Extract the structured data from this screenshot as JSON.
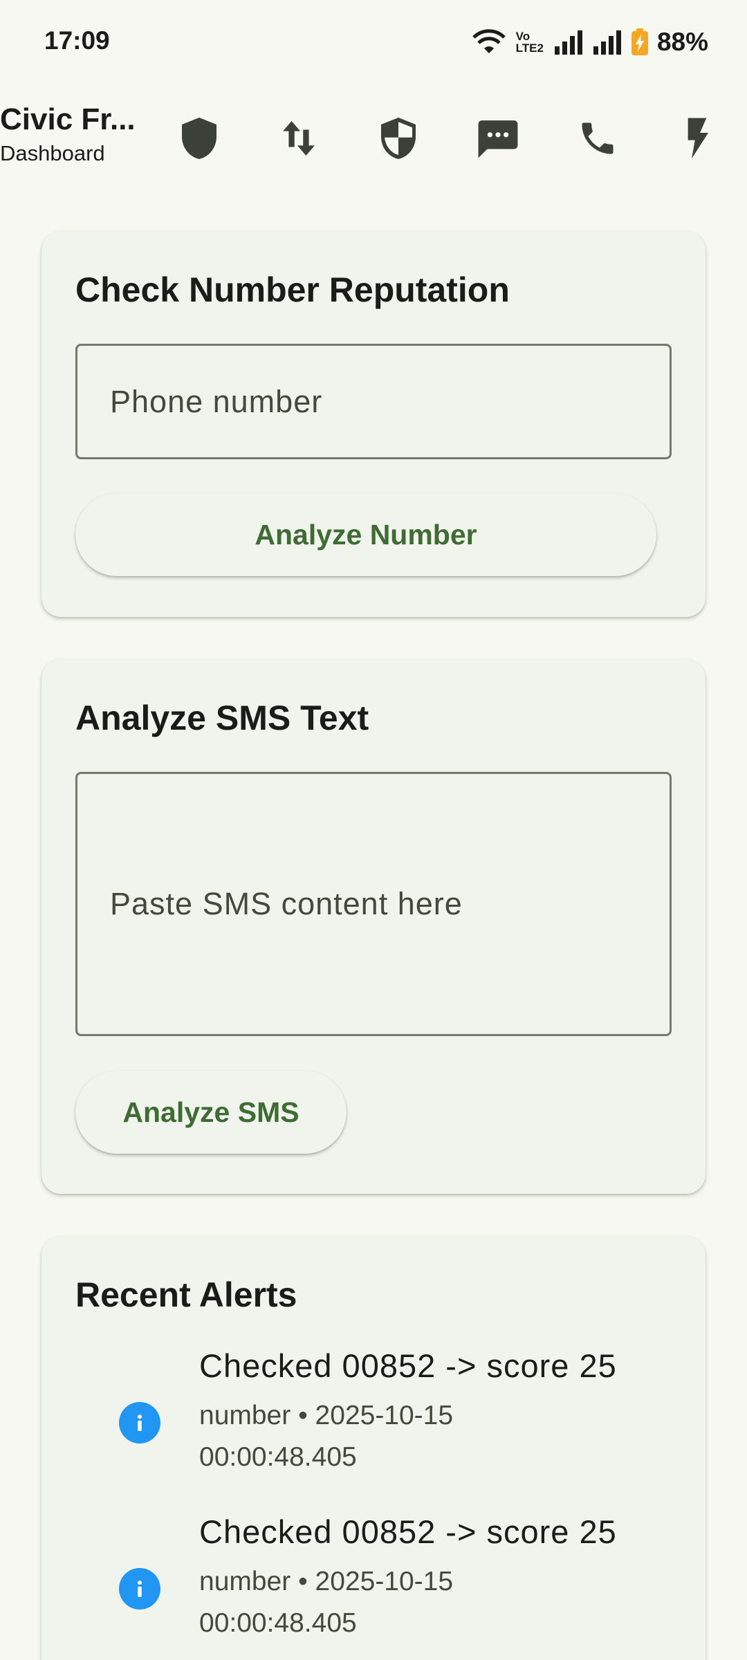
{
  "status_bar": {
    "time": "17:09",
    "volte_top": "Vo",
    "volte_bottom": "LTE2",
    "battery": "88%",
    "icons": [
      "wifi-icon",
      "volte-icon",
      "signal-icon",
      "signal-icon",
      "battery-charging-icon"
    ]
  },
  "app_bar": {
    "title": "Civic Fr...",
    "subtitle": "Dashboard",
    "actions": [
      "shield-icon",
      "swap-vert-icon",
      "security-icon",
      "sms-icon",
      "phone-icon",
      "flash-icon"
    ]
  },
  "number_card": {
    "title": "Check Number Reputation",
    "input_placeholder": "Phone number",
    "button_label": "Analyze Number"
  },
  "sms_card": {
    "title": "Analyze SMS Text",
    "input_placeholder": "Paste SMS content here",
    "button_label": "Analyze SMS"
  },
  "alerts_card": {
    "title": "Recent Alerts",
    "items": [
      {
        "title": "Checked 00852 -> score 25",
        "subtitle": "number • 2025-10-15 00:00:48.405",
        "icon": "info-icon"
      },
      {
        "title": "Checked 00852 -> score 25",
        "subtitle": "number • 2025-10-15 00:00:48.405",
        "icon": "info-icon"
      }
    ]
  },
  "colors": {
    "background": "#f6f8f1",
    "card": "#f1f4ec",
    "primary": "#3f6b34",
    "info": "#2196f3",
    "battery": "#f5a623"
  }
}
